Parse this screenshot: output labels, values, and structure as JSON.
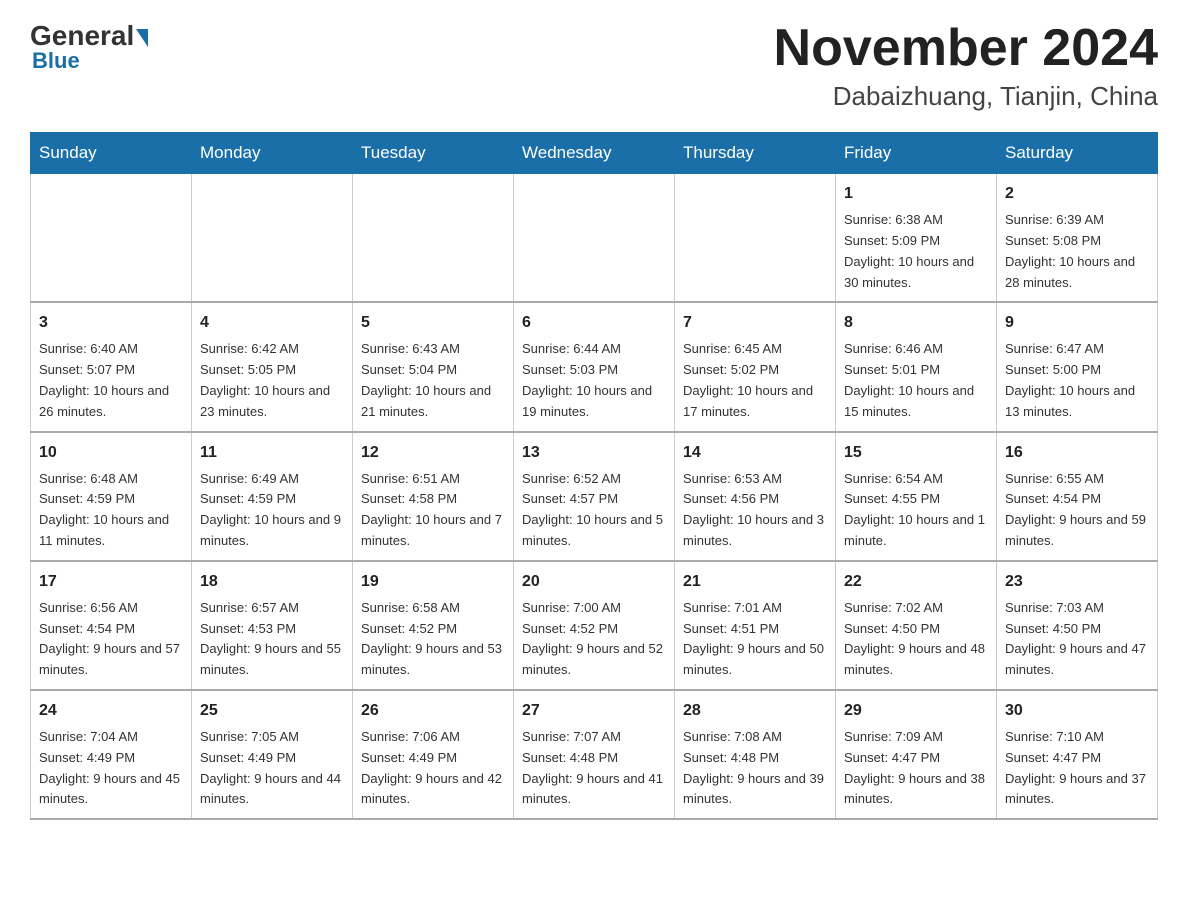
{
  "logo": {
    "general": "General",
    "blue": "Blue",
    "tagline": "Blue"
  },
  "header": {
    "month_year": "November 2024",
    "location": "Dabaizhuang, Tianjin, China"
  },
  "weekdays": [
    "Sunday",
    "Monday",
    "Tuesday",
    "Wednesday",
    "Thursday",
    "Friday",
    "Saturday"
  ],
  "weeks": [
    [
      {
        "day": "",
        "info": ""
      },
      {
        "day": "",
        "info": ""
      },
      {
        "day": "",
        "info": ""
      },
      {
        "day": "",
        "info": ""
      },
      {
        "day": "",
        "info": ""
      },
      {
        "day": "1",
        "info": "Sunrise: 6:38 AM\nSunset: 5:09 PM\nDaylight: 10 hours and 30 minutes."
      },
      {
        "day": "2",
        "info": "Sunrise: 6:39 AM\nSunset: 5:08 PM\nDaylight: 10 hours and 28 minutes."
      }
    ],
    [
      {
        "day": "3",
        "info": "Sunrise: 6:40 AM\nSunset: 5:07 PM\nDaylight: 10 hours and 26 minutes."
      },
      {
        "day": "4",
        "info": "Sunrise: 6:42 AM\nSunset: 5:05 PM\nDaylight: 10 hours and 23 minutes."
      },
      {
        "day": "5",
        "info": "Sunrise: 6:43 AM\nSunset: 5:04 PM\nDaylight: 10 hours and 21 minutes."
      },
      {
        "day": "6",
        "info": "Sunrise: 6:44 AM\nSunset: 5:03 PM\nDaylight: 10 hours and 19 minutes."
      },
      {
        "day": "7",
        "info": "Sunrise: 6:45 AM\nSunset: 5:02 PM\nDaylight: 10 hours and 17 minutes."
      },
      {
        "day": "8",
        "info": "Sunrise: 6:46 AM\nSunset: 5:01 PM\nDaylight: 10 hours and 15 minutes."
      },
      {
        "day": "9",
        "info": "Sunrise: 6:47 AM\nSunset: 5:00 PM\nDaylight: 10 hours and 13 minutes."
      }
    ],
    [
      {
        "day": "10",
        "info": "Sunrise: 6:48 AM\nSunset: 4:59 PM\nDaylight: 10 hours and 11 minutes."
      },
      {
        "day": "11",
        "info": "Sunrise: 6:49 AM\nSunset: 4:59 PM\nDaylight: 10 hours and 9 minutes."
      },
      {
        "day": "12",
        "info": "Sunrise: 6:51 AM\nSunset: 4:58 PM\nDaylight: 10 hours and 7 minutes."
      },
      {
        "day": "13",
        "info": "Sunrise: 6:52 AM\nSunset: 4:57 PM\nDaylight: 10 hours and 5 minutes."
      },
      {
        "day": "14",
        "info": "Sunrise: 6:53 AM\nSunset: 4:56 PM\nDaylight: 10 hours and 3 minutes."
      },
      {
        "day": "15",
        "info": "Sunrise: 6:54 AM\nSunset: 4:55 PM\nDaylight: 10 hours and 1 minute."
      },
      {
        "day": "16",
        "info": "Sunrise: 6:55 AM\nSunset: 4:54 PM\nDaylight: 9 hours and 59 minutes."
      }
    ],
    [
      {
        "day": "17",
        "info": "Sunrise: 6:56 AM\nSunset: 4:54 PM\nDaylight: 9 hours and 57 minutes."
      },
      {
        "day": "18",
        "info": "Sunrise: 6:57 AM\nSunset: 4:53 PM\nDaylight: 9 hours and 55 minutes."
      },
      {
        "day": "19",
        "info": "Sunrise: 6:58 AM\nSunset: 4:52 PM\nDaylight: 9 hours and 53 minutes."
      },
      {
        "day": "20",
        "info": "Sunrise: 7:00 AM\nSunset: 4:52 PM\nDaylight: 9 hours and 52 minutes."
      },
      {
        "day": "21",
        "info": "Sunrise: 7:01 AM\nSunset: 4:51 PM\nDaylight: 9 hours and 50 minutes."
      },
      {
        "day": "22",
        "info": "Sunrise: 7:02 AM\nSunset: 4:50 PM\nDaylight: 9 hours and 48 minutes."
      },
      {
        "day": "23",
        "info": "Sunrise: 7:03 AM\nSunset: 4:50 PM\nDaylight: 9 hours and 47 minutes."
      }
    ],
    [
      {
        "day": "24",
        "info": "Sunrise: 7:04 AM\nSunset: 4:49 PM\nDaylight: 9 hours and 45 minutes."
      },
      {
        "day": "25",
        "info": "Sunrise: 7:05 AM\nSunset: 4:49 PM\nDaylight: 9 hours and 44 minutes."
      },
      {
        "day": "26",
        "info": "Sunrise: 7:06 AM\nSunset: 4:49 PM\nDaylight: 9 hours and 42 minutes."
      },
      {
        "day": "27",
        "info": "Sunrise: 7:07 AM\nSunset: 4:48 PM\nDaylight: 9 hours and 41 minutes."
      },
      {
        "day": "28",
        "info": "Sunrise: 7:08 AM\nSunset: 4:48 PM\nDaylight: 9 hours and 39 minutes."
      },
      {
        "day": "29",
        "info": "Sunrise: 7:09 AM\nSunset: 4:47 PM\nDaylight: 9 hours and 38 minutes."
      },
      {
        "day": "30",
        "info": "Sunrise: 7:10 AM\nSunset: 4:47 PM\nDaylight: 9 hours and 37 minutes."
      }
    ]
  ]
}
